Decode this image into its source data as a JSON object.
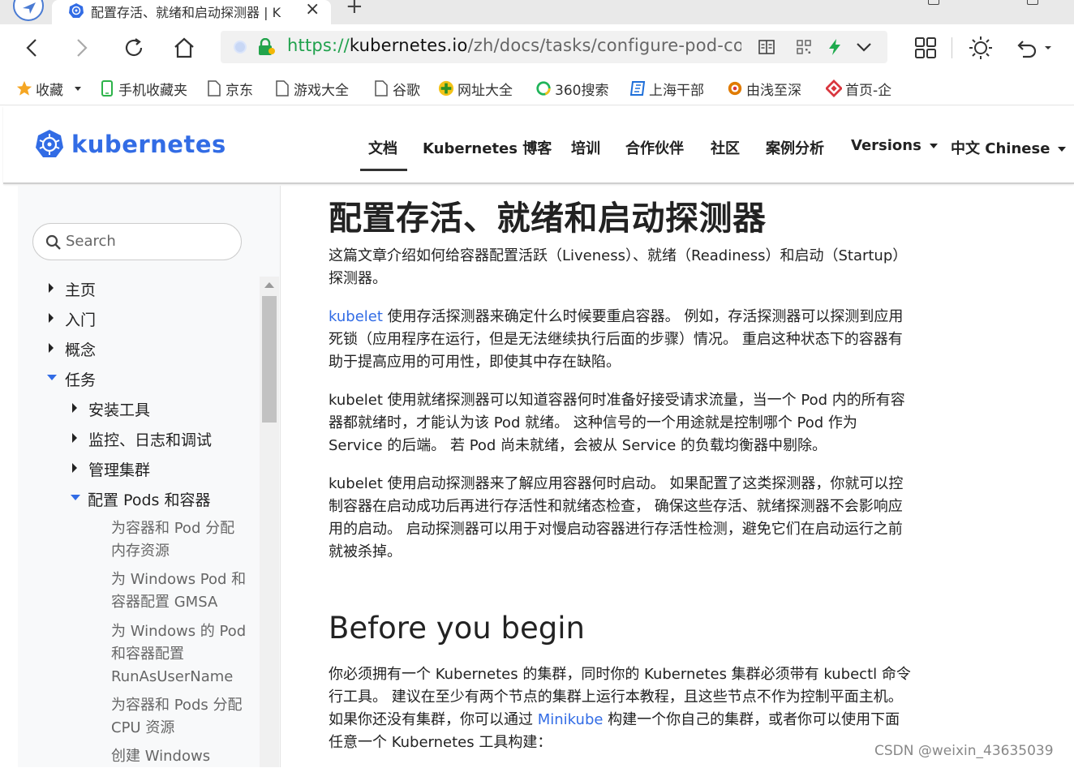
{
  "browser": {
    "tab_title": "配置存活、就绪和启动探测器 | K",
    "tab_close": "×",
    "new_tab": "+",
    "url_scheme": "https://",
    "url_host": "kubernetes.io",
    "url_path": "/zh/docs/tasks/configure-pod-con",
    "icons": [
      "navigation-icon",
      "kubernetes-favicon",
      "back-icon",
      "forward-icon",
      "reload-icon",
      "home-icon",
      "security-shield-icon",
      "lock-icon",
      "reader-mode-icon",
      "qr-code-icon",
      "lightning-icon",
      "chevron-down-icon",
      "apps-grid-icon",
      "brightness-icon",
      "undo-icon"
    ]
  },
  "bookmarks": [
    {
      "label": "收藏",
      "icon": "star-icon",
      "color": "#f5a623"
    },
    {
      "label": "手机收藏夹",
      "icon": "phone-icon",
      "color": "#2db34a"
    },
    {
      "label": "京东",
      "icon": "page-icon"
    },
    {
      "label": "游戏大全",
      "icon": "page-icon"
    },
    {
      "label": "谷歌",
      "icon": "page-icon"
    },
    {
      "label": "网址大全",
      "icon": "plus-circle-icon",
      "color": "#43b02a"
    },
    {
      "label": "360搜索",
      "icon": "search-360-icon",
      "color": "#20b45a"
    },
    {
      "label": "上海干部",
      "icon": "book-icon",
      "color": "#1e6fd9"
    },
    {
      "label": "由浅至深",
      "icon": "gear-flower-icon",
      "color": "#e07b00"
    },
    {
      "label": "首页-企",
      "icon": "diamond-icon",
      "color": "#d9363e"
    }
  ],
  "site": {
    "brand": "kubernetes",
    "brand_color": "#326ce5",
    "nav": [
      {
        "label": "文档",
        "active": true
      },
      {
        "label": "Kubernetes 博客"
      },
      {
        "label": "培训"
      },
      {
        "label": "合作伙伴"
      },
      {
        "label": "社区"
      },
      {
        "label": "案例分析"
      },
      {
        "label": "Versions",
        "dropdown": true
      },
      {
        "label": "中文 Chinese",
        "dropdown": true
      }
    ]
  },
  "sidebar": {
    "search_placeholder": "Search",
    "tree": [
      {
        "label": "主页",
        "state": "collapsed"
      },
      {
        "label": "入门",
        "state": "collapsed"
      },
      {
        "label": "概念",
        "state": "collapsed"
      },
      {
        "label": "任务",
        "state": "expanded"
      },
      {
        "label": "安装工具",
        "state": "collapsed"
      },
      {
        "label": "监控、日志和调试",
        "state": "collapsed"
      },
      {
        "label": "管理集群",
        "state": "collapsed"
      },
      {
        "label": "配置 Pods 和容器",
        "state": "expanded"
      }
    ],
    "leaves": [
      "为容器和 Pod 分配内存资源",
      "为 Windows Pod 和容器配置 GMSA",
      "为 Windows 的 Pod 和容器配置 RunAsUserName",
      "为容器和 Pods 分配 CPU 资源",
      "创建 Windows"
    ]
  },
  "content": {
    "title": "配置存活、就绪和启动探测器",
    "intro": "这篇文章介绍如何给容器配置活跃（Liveness）、就绪（Readiness）和启动（Startup）探测器。",
    "p1_link": "kubelet",
    "p1_rest": " 使用存活探测器来确定什么时候要重启容器。 例如，存活探测器可以探测到应用死锁（应用程序在运行，但是无法继续执行后面的步骤）情况。 重启这种状态下的容器有助于提高应用的可用性，即使其中存在缺陷。",
    "p2": "kubelet 使用就绪探测器可以知道容器何时准备好接受请求流量，当一个 Pod 内的所有容器都就绪时，才能认为该 Pod 就绪。 这种信号的一个用途就是控制哪个 Pod 作为 Service 的后端。 若 Pod 尚未就绪，会被从 Service 的负载均衡器中剔除。",
    "p3": "kubelet 使用启动探测器来了解应用容器何时启动。 如果配置了这类探测器，你就可以控制容器在启动成功后再进行存活性和就绪态检查， 确保这些存活、就绪探测器不会影响应用的启动。 启动探测器可以用于对慢启动容器进行存活性检测，避免它们在启动运行之前就被杀掉。",
    "h2": "Before you begin",
    "p4_a": "你必须拥有一个 Kubernetes 的集群，同时你的 Kubernetes 集群必须带有 kubectl 命令行工具。 建议在至少有两个节点的集群上运行本教程，且这些节点不作为控制平面主机。 如果你还没有集群，你可以通过 ",
    "p4_link": "Minikube",
    "p4_b": " 构建一个你自己的集群，或者你可以使用下面任意一个 Kubernetes 工具构建："
  },
  "watermark": "CSDN @weixin_43635039"
}
